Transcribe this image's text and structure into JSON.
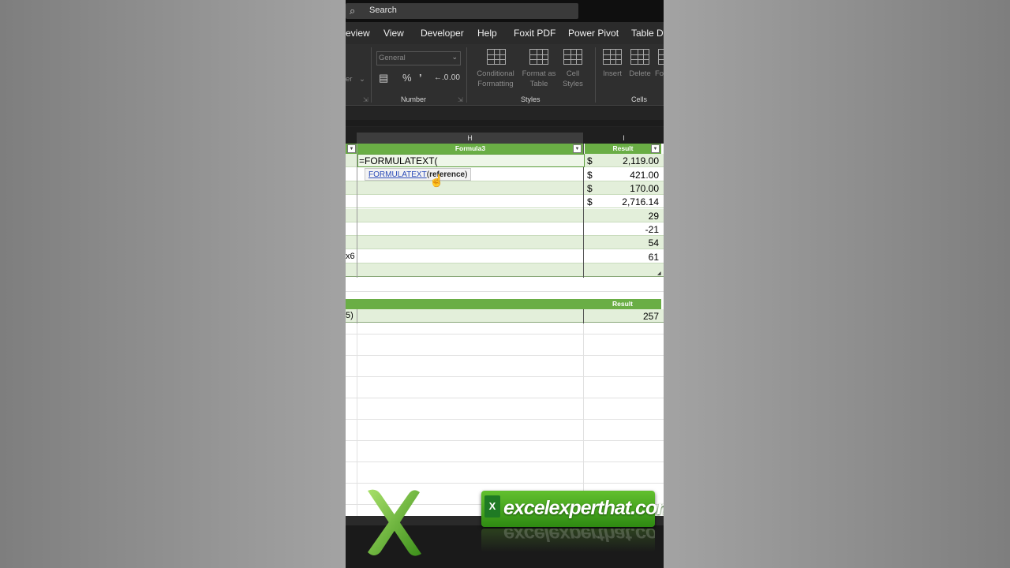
{
  "search": {
    "placeholder": "Search"
  },
  "tabs": [
    {
      "label": "eview"
    },
    {
      "label": "View"
    },
    {
      "label": "Developer"
    },
    {
      "label": "Help"
    },
    {
      "label": "Foxit PDF"
    },
    {
      "label": "Power Pivot"
    },
    {
      "label": "Table De"
    }
  ],
  "ribbon": {
    "number_format": "General",
    "number_group": "Number",
    "styles_group": "Styles",
    "cells_group": "Cells",
    "left_cut": "er",
    "conditional_formatting_1": "Conditional",
    "conditional_formatting_2": "Formatting",
    "format_as_table_1": "Format as",
    "format_as_table_2": "Table",
    "cell_styles_1": "Cell",
    "cell_styles_2": "Styles",
    "insert": "Insert",
    "delete": "Delete",
    "format_cut": "Fo"
  },
  "columns": {
    "h": "H",
    "i": "I"
  },
  "table1": {
    "formula_header": "Formula3",
    "result_header": "Result",
    "editing_text": "=FORMULATEXT(",
    "tooltip_fn": "FORMULATEXT",
    "tooltip_arg": "reference",
    "row_cut_text": "x6",
    "results": [
      {
        "dollar": "$",
        "value": "2,119.00"
      },
      {
        "dollar": "$",
        "value": "421.00"
      },
      {
        "dollar": "$",
        "value": "170.00"
      },
      {
        "dollar": "$",
        "value": "2,716.14"
      },
      {
        "dollar": "",
        "value": "29"
      },
      {
        "dollar": "",
        "value": "-21"
      },
      {
        "dollar": "",
        "value": "54"
      },
      {
        "dollar": "",
        "value": "61"
      }
    ]
  },
  "table2": {
    "result_header": "Result",
    "row_cut_text": "5)",
    "value": "257"
  },
  "watermark": {
    "icon_letter": "X",
    "brand": "excelexperthat.com"
  },
  "colors": {
    "accent": "#6aae45",
    "band": "#e3efda",
    "dark_ui": "#2f2f2f"
  }
}
